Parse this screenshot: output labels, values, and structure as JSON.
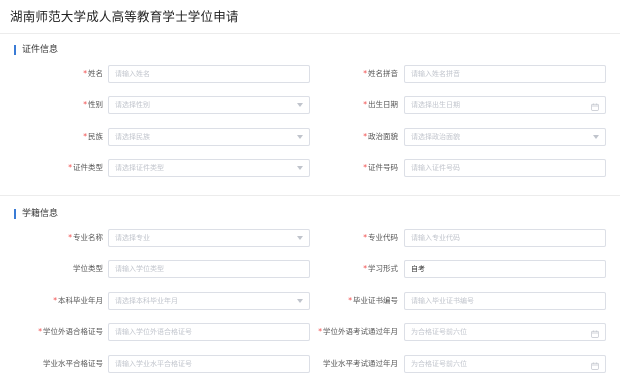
{
  "page": {
    "title": "湖南师范大学成人高等教育学士学位申请"
  },
  "sections": {
    "cert": {
      "title": "证件信息",
      "rows": [
        {
          "left": {
            "label": "姓名",
            "required": true,
            "placeholder": "请输入姓名",
            "value": "",
            "type": "text"
          },
          "right": {
            "label": "姓名拼音",
            "required": true,
            "placeholder": "请输入姓名拼音",
            "value": "",
            "type": "text"
          }
        },
        {
          "left": {
            "label": "性别",
            "required": true,
            "placeholder": "请选择性别",
            "value": "",
            "type": "select"
          },
          "right": {
            "label": "出生日期",
            "required": true,
            "placeholder": "请选择出生日期",
            "value": "",
            "type": "date"
          }
        },
        {
          "left": {
            "label": "民族",
            "required": true,
            "placeholder": "请选择民族",
            "value": "",
            "type": "select"
          },
          "right": {
            "label": "政治面貌",
            "required": true,
            "placeholder": "请选择政治面貌",
            "value": "",
            "type": "select"
          }
        },
        {
          "left": {
            "label": "证件类型",
            "required": true,
            "placeholder": "请选择证件类型",
            "value": "",
            "type": "select"
          },
          "right": {
            "label": "证件号码",
            "required": true,
            "placeholder": "请输入证件号码",
            "value": "",
            "type": "text"
          }
        }
      ]
    },
    "edu": {
      "title": "学籍信息",
      "rows": [
        {
          "left": {
            "label": "专业名称",
            "required": true,
            "placeholder": "请选择专业",
            "value": "",
            "type": "select"
          },
          "right": {
            "label": "专业代码",
            "required": true,
            "placeholder": "请输入专业代码",
            "value": "",
            "type": "text"
          }
        },
        {
          "left": {
            "label": "学位类型",
            "required": false,
            "placeholder": "请输入学位类型",
            "value": "",
            "type": "text"
          },
          "right": {
            "label": "学习形式",
            "required": true,
            "placeholder": "",
            "value": "自考",
            "type": "text"
          }
        },
        {
          "left": {
            "label": "本科毕业年月",
            "required": true,
            "placeholder": "请选择本科毕业年月",
            "value": "",
            "type": "select"
          },
          "right": {
            "label": "毕业证书编号",
            "required": true,
            "placeholder": "请输入毕业证书编号",
            "value": "",
            "type": "text"
          }
        },
        {
          "left": {
            "label": "学位外语合格证号",
            "required": true,
            "placeholder": "请输入学位外语合格证号",
            "value": "",
            "type": "text"
          },
          "right": {
            "label": "学位外语考试通过年月",
            "required": true,
            "placeholder": "为合格证号前六位",
            "value": "",
            "type": "date"
          }
        },
        {
          "left": {
            "label": "学业水平合格证号",
            "required": false,
            "placeholder": "请输入学业水平合格证号",
            "value": "",
            "type": "text"
          },
          "right": {
            "label": "学业水平考试通过年月",
            "required": false,
            "placeholder": "为合格证号前六位",
            "value": "",
            "type": "date"
          }
        }
      ]
    }
  },
  "colors": {
    "accent": "#3a7bd5",
    "required": "#f04848",
    "placeholder": "#c0c4cc",
    "border": "#dcdfe6"
  },
  "icons": {
    "select": "chevron-down-icon",
    "date": "calendar-icon"
  }
}
